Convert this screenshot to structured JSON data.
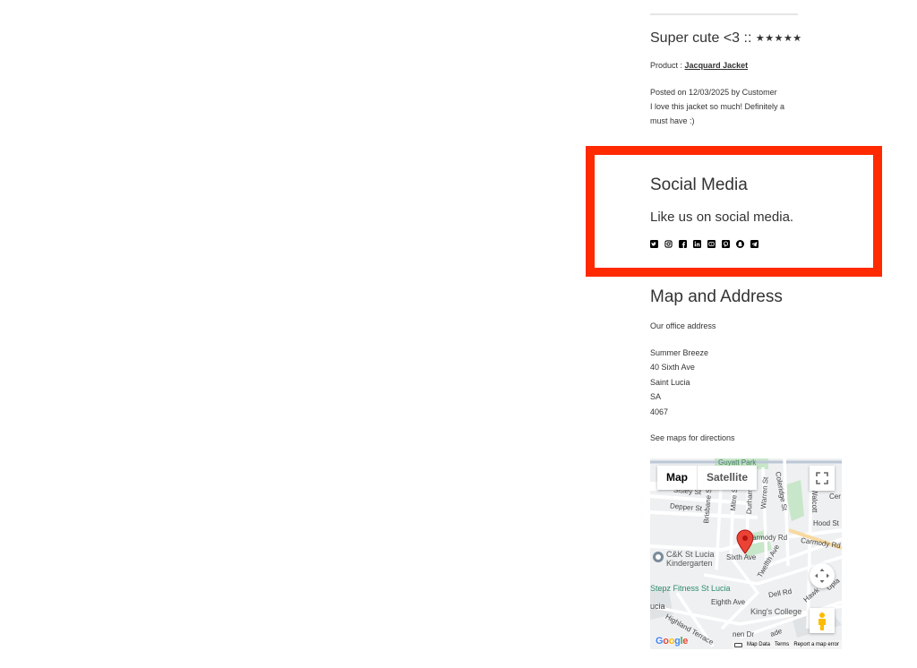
{
  "review": {
    "title": "Super cute <3 ::",
    "stars": "★★★★★",
    "product_prefix": "Product :",
    "product_link": "Jacquard Jacket",
    "posted": "Posted on 12/03/2025  by Customer",
    "body": "I love this jacket so much! Definitely a must have :)"
  },
  "social": {
    "heading": "Social Media",
    "text": "Like us on social media.",
    "icons": [
      "twitter-icon",
      "instagram-icon",
      "facebook-icon",
      "linkedin-icon",
      "youtube-icon",
      "pinterest-icon",
      "snapchat-icon",
      "telegram-icon"
    ]
  },
  "map_section": {
    "heading": "Map and Address",
    "office_label": "Our office address",
    "address": [
      "Summer Breeze",
      "40 Sixth Ave",
      "Saint Lucia",
      "SA",
      "4067"
    ],
    "directions": "See maps for directions"
  },
  "map": {
    "toggle_map": "Map",
    "toggle_satellite": "Satellite",
    "google": "Google",
    "footer_map_data": "Map Data",
    "footer_terms": "Terms",
    "footer_report": "Report a map error",
    "labels": {
      "guyatt_park": "Guyatt Park",
      "sisley": "Sisley St",
      "depper": "Depper St",
      "brisbane": "Brisbane St",
      "mitre": "Mitre St",
      "durham": "Durham St",
      "warren": "Warren St",
      "coleridge": "Coleridge St",
      "walcott": "Walcott",
      "cer": "Cer",
      "hood": "Hood St",
      "carmody": "armody Rd",
      "carmody2": "Carmody Rd",
      "ck_line1": "C&K St Lucia",
      "ck_line2": "Kindergarten",
      "sixth": "Sixth Ave",
      "twelfth": "Twelfth Ave",
      "stepz": "Stepz Fitness St Lucia",
      "ucia": "ucia",
      "eighth": "Eighth Ave",
      "dell": "Dell Rd",
      "hawken": "Hawk",
      "upland": "Upla",
      "kings": "King's College",
      "highland": "Highland Terrace",
      "ngen": "nen Dr",
      "ade": "ade"
    },
    "colors": {
      "marker": "#ea4335",
      "park": "#c8e6c9",
      "road": "#ffffff",
      "major_road": "#f8d9a0"
    }
  }
}
